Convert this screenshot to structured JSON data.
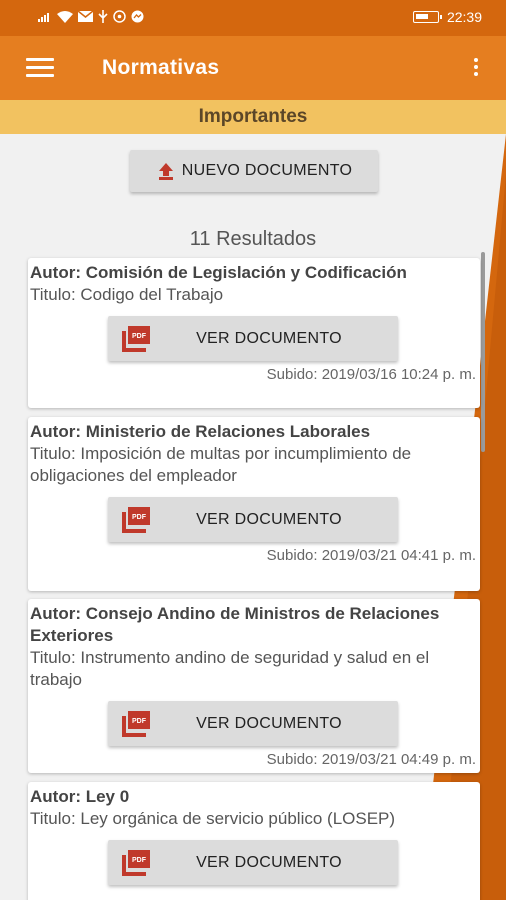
{
  "status_bar": {
    "time": "22:39"
  },
  "app_bar": {
    "title": "Normativas"
  },
  "section_title": "Importantes",
  "new_document_label": "NUEVO DOCUMENTO",
  "results_text": "11 Resultados",
  "cards": [
    {
      "autor": "Autor: Comisión de Legislación y Codificación",
      "titulo": "Titulo: Codigo del Trabajo",
      "button": "VER DOCUMENTO",
      "subido": "Subido: 2019/03/16 10:24 p. m."
    },
    {
      "autor": "Autor: Ministerio de Relaciones Laborales",
      "titulo": "Titulo: Imposición de multas por incumplimiento de obligaciones del empleador",
      "button": "VER DOCUMENTO",
      "subido": "Subido: 2019/03/21 04:41 p. m."
    },
    {
      "autor": "Autor: Consejo Andino de Ministros de Relaciones Exteriores",
      "titulo": "Titulo: Instrumento andino de seguridad y salud en el trabajo",
      "button": "VER DOCUMENTO",
      "subido": "Subido: 2019/03/21 04:49 p. m."
    },
    {
      "autor": "Autor: Ley 0",
      "titulo": "Titulo: Ley orgánica de servicio público (LOSEP)",
      "button": "VER DOCUMENTO",
      "subido": ""
    }
  ],
  "colors": {
    "status_bar": "#d4670e",
    "app_bar": "#e57e20",
    "section": "#f2c260",
    "accent_red": "#c0392b"
  },
  "icons": [
    "menu-icon",
    "more-vert-icon",
    "upload-icon",
    "pdf-icon",
    "signal-icon",
    "wifi-icon",
    "mail-icon",
    "usb-icon",
    "whatsapp-icon",
    "messenger-icon",
    "battery-icon"
  ]
}
